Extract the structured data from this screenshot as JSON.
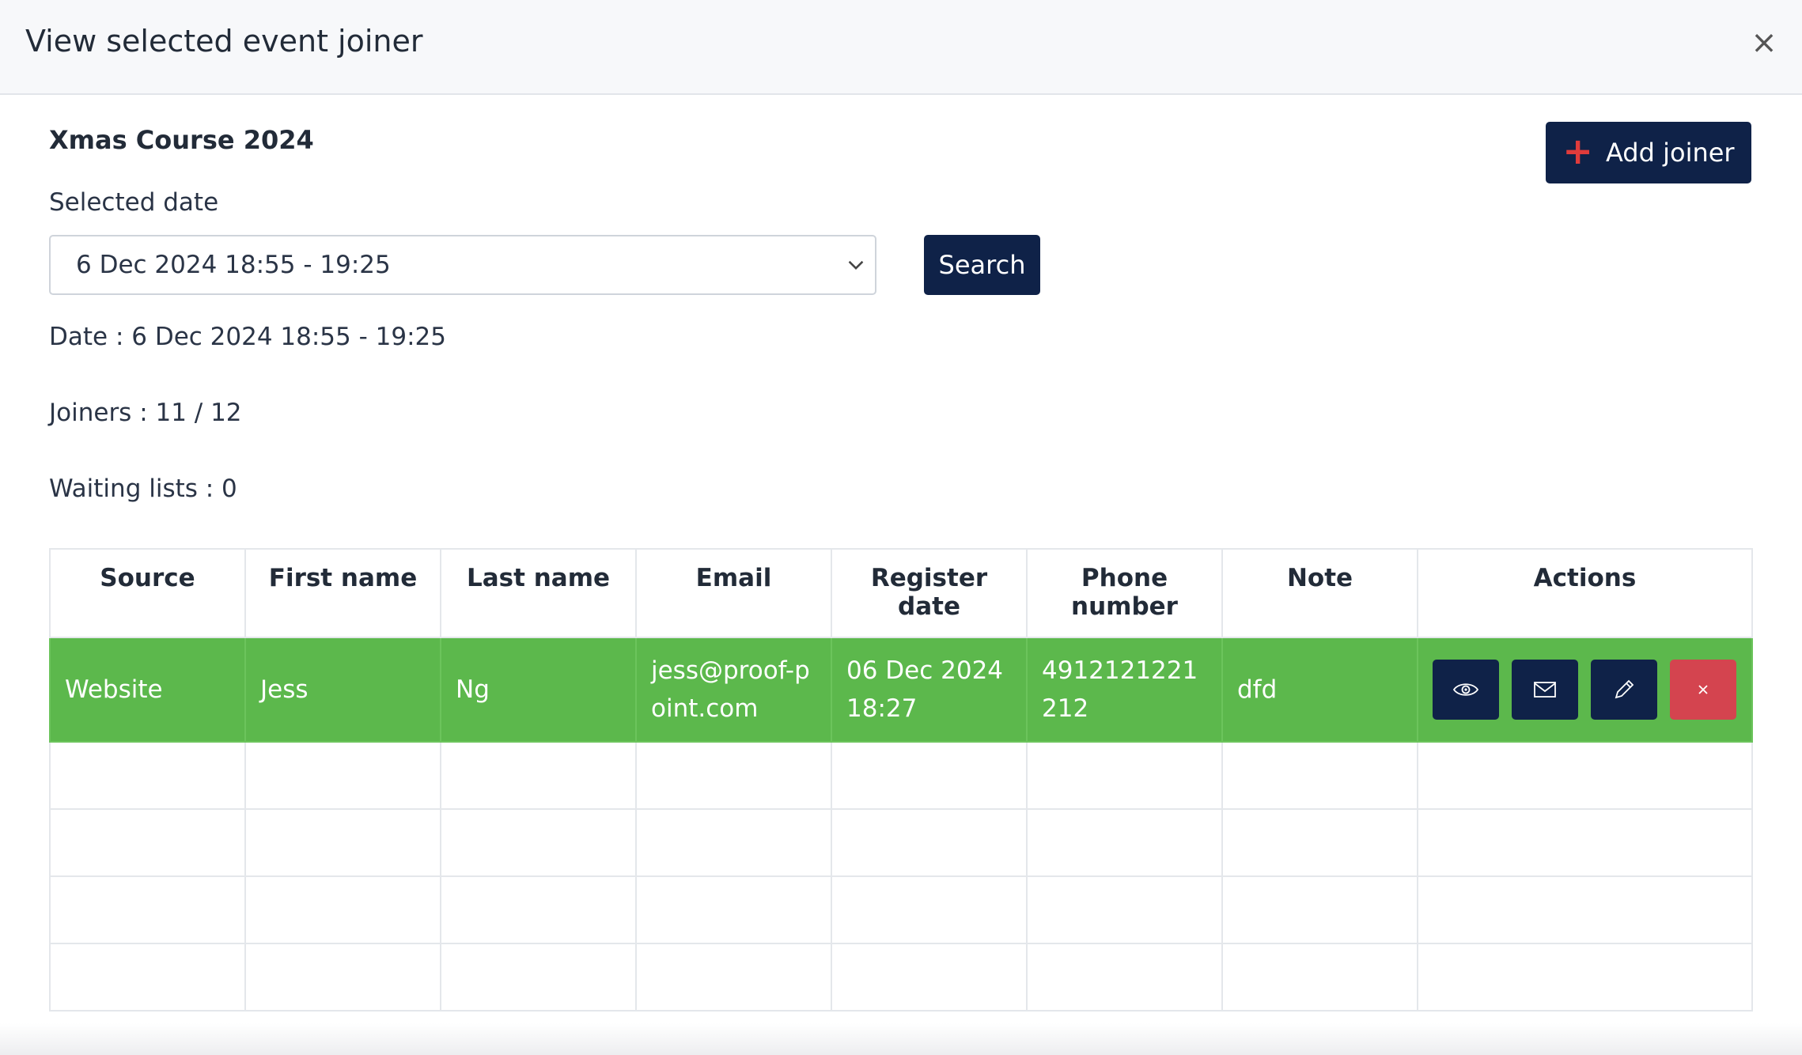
{
  "header": {
    "title": "View selected event joiner",
    "close_label": "×"
  },
  "event": {
    "title": "Xmas Course 2024"
  },
  "toolbar": {
    "add_joiner_label": "Add joiner"
  },
  "filter": {
    "label": "Selected date",
    "selected_value": "6 Dec 2024 18:55 - 19:25",
    "search_label": "Search"
  },
  "info": {
    "date": "Date : 6 Dec 2024 18:55 - 19:25",
    "joiners": "Joiners : 11 / 12",
    "waiting": "Waiting lists : 0"
  },
  "table": {
    "headers": [
      "Source",
      "First name",
      "Last name",
      "Email",
      "Register date",
      "Phone number",
      "Note",
      "Actions"
    ],
    "rows": [
      {
        "source": "Website",
        "first_name": "Jess",
        "last_name": "Ng",
        "email": "jess@proof-point.com",
        "register_date": "06 Dec 2024 18:27",
        "phone": "4912121221212",
        "note": "dfd"
      }
    ]
  },
  "colors": {
    "primary": "#0f2248",
    "row_highlight": "#5cb84c",
    "danger": "#d4444f",
    "plus_accent": "#e03b3b"
  },
  "icons": {
    "view": "eye-icon",
    "email": "envelope-icon",
    "edit": "pencil-icon",
    "delete": "close-icon"
  }
}
